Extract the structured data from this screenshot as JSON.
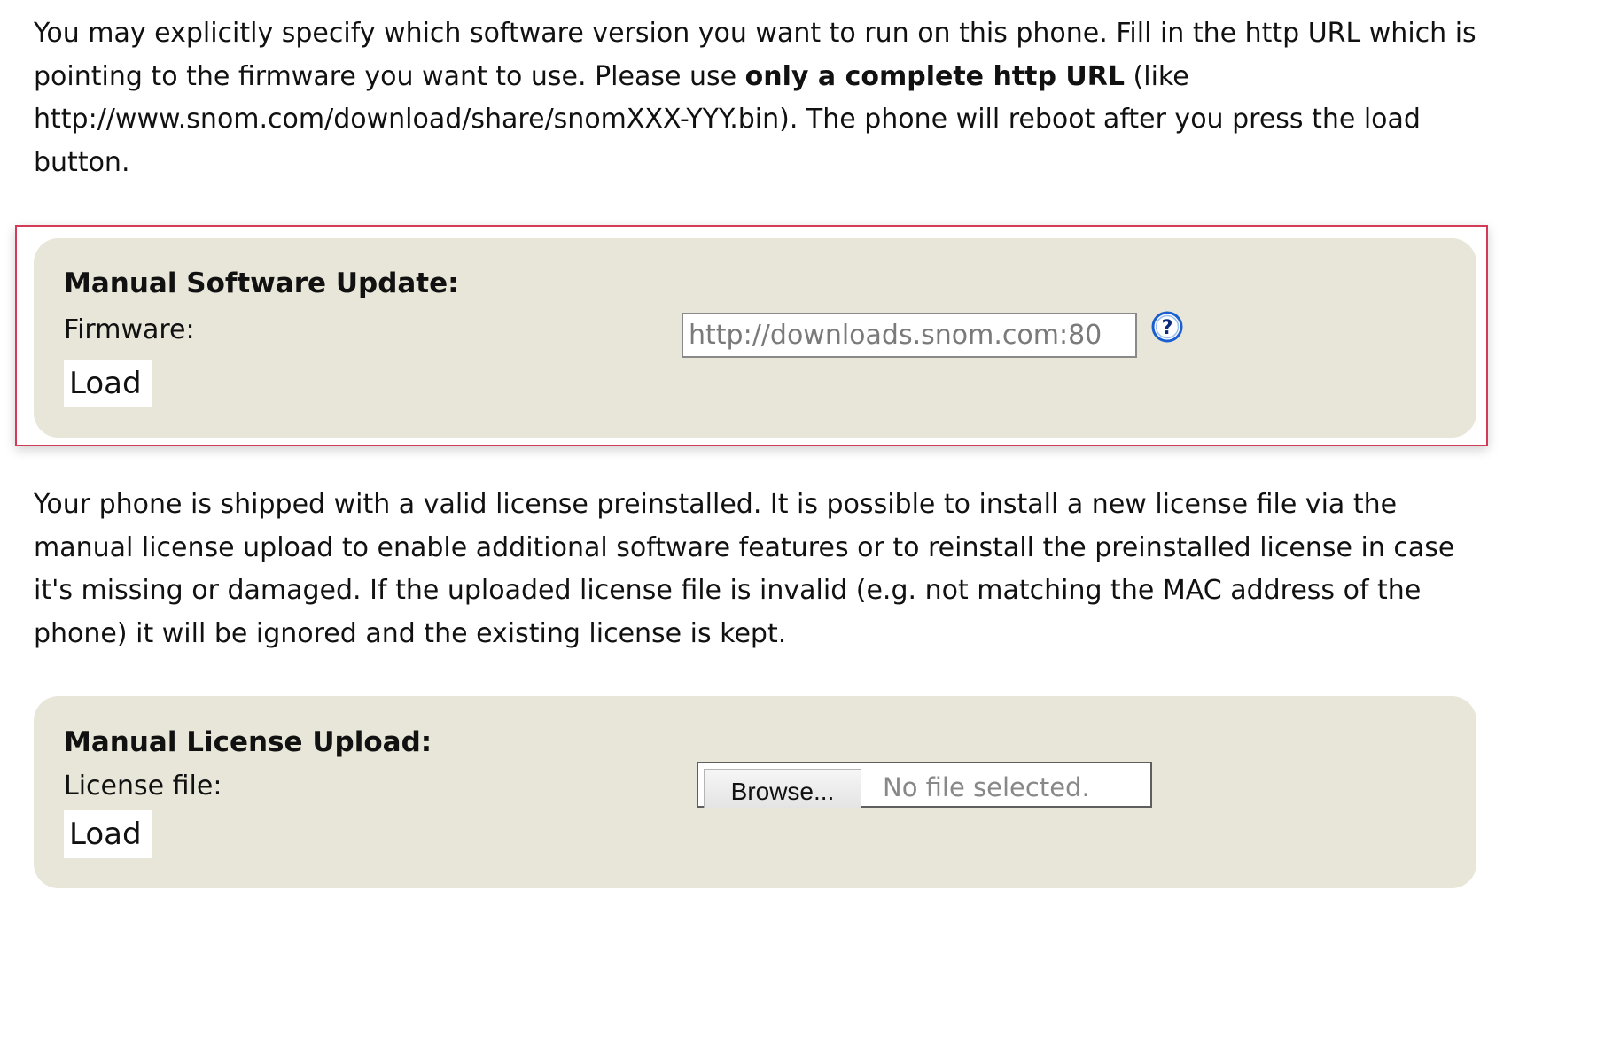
{
  "intro": {
    "text_before_bold": "You may explicitly specify which software version you want to run on this phone. Fill in the http URL which is pointing to the firmware you want to use. Please use ",
    "bold_text": "only a complete http URL",
    "text_after_bold": " (like http://www.snom.com/download/share/snomXXX-YYY.bin). The phone will reboot after you press the load button."
  },
  "software_update": {
    "title": "Manual Software Update:",
    "firmware_label": "Firmware:",
    "firmware_value": "http://downloads.snom.com:80",
    "help_icon": "question-mark-circle-icon",
    "help_glyph": "?",
    "load_label": "Load",
    "highlight_color": "#d23a55"
  },
  "license_info": {
    "text": "Your phone is shipped with a valid license preinstalled. It is possible to install a new license file via the manual license upload to enable additional software features or to reinstall the preinstalled license in case it's missing or damaged. If the uploaded license file is invalid (e.g. not matching the MAC address of the phone) it will be ignored and the existing license is kept."
  },
  "license_upload": {
    "title": "Manual License Upload:",
    "file_label": "License file:",
    "browse_label": "Browse...",
    "file_status": "No file selected.",
    "load_label": "Load"
  },
  "colors": {
    "panel_background": "#e8e6d8",
    "help_icon_blue": "#1a5fd0"
  }
}
